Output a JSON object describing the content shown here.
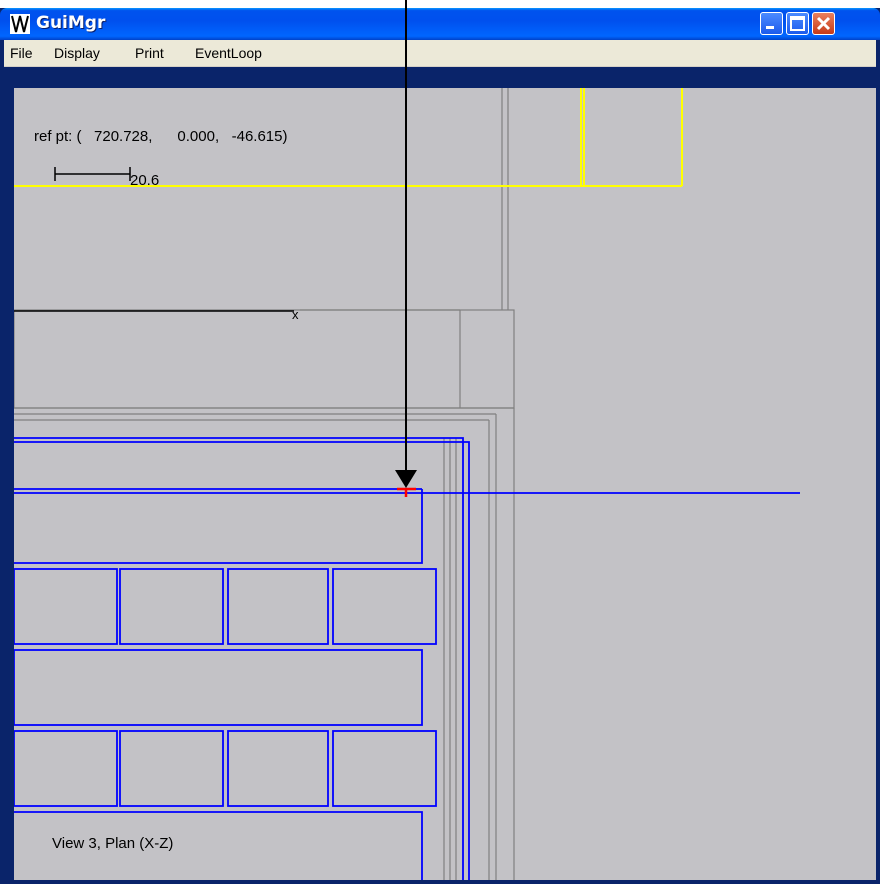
{
  "window": {
    "title": "GuiMgr",
    "icon": "app-icon"
  },
  "menu": [
    "File",
    "Display",
    "Print",
    "EventLoop"
  ],
  "viewport": {
    "ref_point": "ref pt: (   720.728,      0.000,   -46.615)",
    "scale_label": "20.6",
    "view_label": "View 3, Plan (X-Z)",
    "marker_label": "x"
  },
  "colors": {
    "canvas_bg": "#c3c2c6",
    "blue_lines": "#0000ff",
    "yellow_lines": "#ffff00",
    "gray_lines": "#808080",
    "pick": "#ff0000"
  }
}
